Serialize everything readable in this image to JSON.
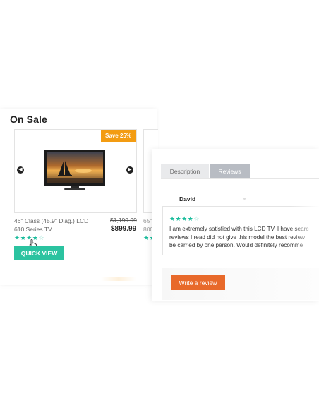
{
  "on_sale": {
    "title": "On Sale",
    "badge": "Save 25%",
    "product": {
      "name_line1": "46\" Class (45.9\" Diag.) LCD",
      "name_line2": "610 Series TV",
      "old_price": "$1,199.99",
      "new_price": "$899.99",
      "rating": 4,
      "rating_max": 5
    },
    "next_product": {
      "name_line1": "65\"",
      "name_line2": "800"
    },
    "quick_view_label": "QUICK VIEW",
    "colors": {
      "badge": "#f39c12",
      "quick_view": "#2bc3a0",
      "stars": "#1abc9c"
    }
  },
  "reviews_panel": {
    "tabs": [
      {
        "label": "Description",
        "active": false
      },
      {
        "label": "Reviews",
        "active": true
      }
    ],
    "review": {
      "author": "David",
      "rating": 4,
      "rating_max": 5,
      "text_lines": [
        "I am extremely satisfied with this LCD TV. I have searc",
        "reviews I read did not give this model the best review",
        "be carried by one person. Would definitely recomme"
      ]
    },
    "write_review_label": "Write a review",
    "colors": {
      "write_review": "#e8692a"
    }
  },
  "icons": {
    "prev": "chevron-left-icon",
    "next": "chevron-right-icon",
    "cursor": "hand-pointer-icon"
  }
}
